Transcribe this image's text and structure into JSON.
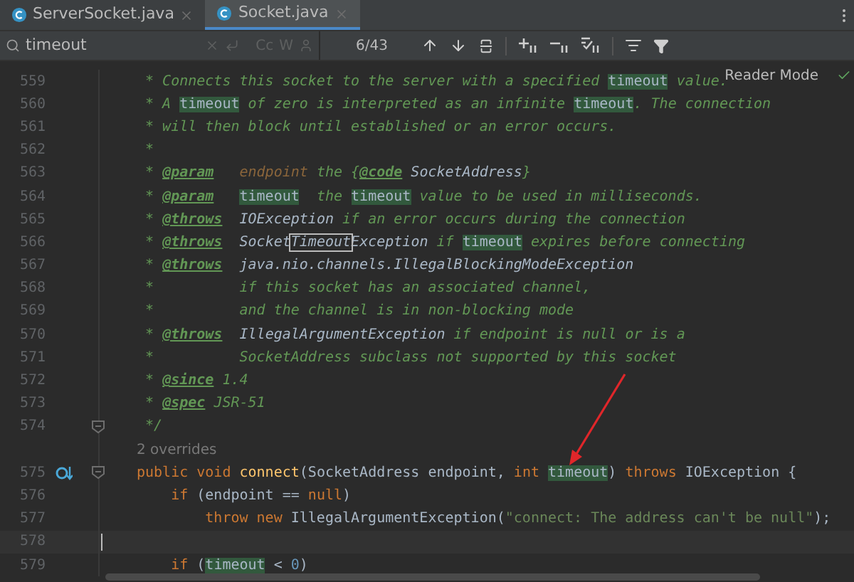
{
  "tabs": [
    {
      "label": "ServerSocket.java",
      "selected": false
    },
    {
      "label": "Socket.java",
      "selected": true
    }
  ],
  "search": {
    "value": "timeout",
    "case_option": "Cc",
    "word_option": "W",
    "match_count": "6/43"
  },
  "reader_mode": "Reader Mode",
  "lines": [
    {
      "kind": "code",
      "number": "559",
      "current": false,
      "fold": false,
      "override": false,
      "tokens": [
        {
          "kind": "doc",
          "text": " * Connects this socket to the server with a specified "
        },
        {
          "kind": "match",
          "text": "timeout"
        },
        {
          "kind": "doc",
          "text": " value."
        }
      ]
    },
    {
      "kind": "code",
      "number": "560",
      "current": false,
      "fold": false,
      "override": false,
      "tokens": [
        {
          "kind": "doc",
          "text": " * A "
        },
        {
          "kind": "match",
          "text": "timeout"
        },
        {
          "kind": "doc",
          "text": " of zero is interpreted as an infinite "
        },
        {
          "kind": "match",
          "text": "timeout"
        },
        {
          "kind": "doc",
          "text": ". The connection"
        }
      ]
    },
    {
      "kind": "code",
      "number": "561",
      "current": false,
      "fold": false,
      "override": false,
      "tokens": [
        {
          "kind": "doc",
          "text": " * will then block until established or an error occurs."
        }
      ]
    },
    {
      "kind": "code",
      "number": "562",
      "current": false,
      "fold": false,
      "override": false,
      "tokens": [
        {
          "kind": "doc",
          "text": " *"
        }
      ]
    },
    {
      "kind": "code",
      "number": "563",
      "current": false,
      "fold": false,
      "override": false,
      "tokens": [
        {
          "kind": "doc",
          "text": " * "
        },
        {
          "kind": "tag",
          "text": "@param"
        },
        {
          "kind": "param",
          "text": "   endpoint"
        },
        {
          "kind": "doc",
          "text": " the {"
        },
        {
          "kind": "tag",
          "text": "@code"
        },
        {
          "kind": "ref",
          "text": " SocketAddress"
        },
        {
          "kind": "doc",
          "text": "}"
        }
      ]
    },
    {
      "kind": "code",
      "number": "564",
      "current": false,
      "fold": false,
      "override": false,
      "tokens": [
        {
          "kind": "doc",
          "text": " * "
        },
        {
          "kind": "tag",
          "text": "@param   "
        },
        {
          "kind": "match",
          "text": "timeout"
        },
        {
          "kind": "doc",
          "text": "  the "
        },
        {
          "kind": "match",
          "text": "timeout"
        },
        {
          "kind": "doc",
          "text": " value to be used in milliseconds."
        }
      ]
    },
    {
      "kind": "code",
      "number": "565",
      "current": false,
      "fold": false,
      "override": false,
      "tokens": [
        {
          "kind": "doc",
          "text": " * "
        },
        {
          "kind": "tag",
          "text": "@throws"
        },
        {
          "kind": "ref",
          "text": "  IOException"
        },
        {
          "kind": "doc",
          "text": " if an error occurs during the connection"
        }
      ]
    },
    {
      "kind": "code",
      "number": "566",
      "current": false,
      "fold": false,
      "override": false,
      "tokens": [
        {
          "kind": "doc",
          "text": " * "
        },
        {
          "kind": "tag",
          "text": "@throws"
        },
        {
          "kind": "ref",
          "text": "  Socket"
        },
        {
          "kind": "current",
          "text": "Timeout"
        },
        {
          "kind": "ref",
          "text": "Exception"
        },
        {
          "kind": "doc",
          "text": " if "
        },
        {
          "kind": "match",
          "text": "timeout"
        },
        {
          "kind": "doc",
          "text": " expires before connecting"
        }
      ]
    },
    {
      "kind": "code",
      "number": "567",
      "current": false,
      "fold": false,
      "override": false,
      "tokens": [
        {
          "kind": "doc",
          "text": " * "
        },
        {
          "kind": "tag",
          "text": "@throws"
        },
        {
          "kind": "ref",
          "text": "  java.nio.channels.IllegalBlockingModeException"
        }
      ]
    },
    {
      "kind": "code",
      "number": "568",
      "current": false,
      "fold": false,
      "override": false,
      "tokens": [
        {
          "kind": "doc",
          "text": " *          if this socket has an associated channel,"
        }
      ]
    },
    {
      "kind": "code",
      "number": "569",
      "current": false,
      "fold": false,
      "override": false,
      "tokens": [
        {
          "kind": "doc",
          "text": " *          and the channel is in non-blocking mode"
        }
      ]
    },
    {
      "kind": "code",
      "number": "570",
      "current": false,
      "fold": false,
      "override": false,
      "tokens": [
        {
          "kind": "doc",
          "text": " * "
        },
        {
          "kind": "tag",
          "text": "@throws"
        },
        {
          "kind": "ref",
          "text": "  IllegalArgumentException"
        },
        {
          "kind": "doc",
          "text": " if endpoint is null or is a"
        }
      ]
    },
    {
      "kind": "code",
      "number": "571",
      "current": false,
      "fold": false,
      "override": false,
      "tokens": [
        {
          "kind": "doc",
          "text": " *          SocketAddress subclass not supported by this socket"
        }
      ]
    },
    {
      "kind": "code",
      "number": "572",
      "current": false,
      "fold": false,
      "override": false,
      "tokens": [
        {
          "kind": "doc",
          "text": " * "
        },
        {
          "kind": "tag",
          "text": "@since"
        },
        {
          "kind": "doc",
          "text": " 1.4"
        }
      ]
    },
    {
      "kind": "code",
      "number": "573",
      "current": false,
      "fold": false,
      "override": false,
      "tokens": [
        {
          "kind": "doc",
          "text": " * "
        },
        {
          "kind": "tag",
          "text": "@spec"
        },
        {
          "kind": "doc",
          "text": " JSR-51"
        }
      ]
    },
    {
      "kind": "code",
      "number": "574",
      "current": false,
      "fold": true,
      "override": false,
      "tokens": [
        {
          "kind": "doc",
          "text": " */"
        }
      ]
    },
    {
      "kind": "hint",
      "text": "2 overrides"
    },
    {
      "kind": "code",
      "number": "575",
      "current": false,
      "fold": true,
      "override": true,
      "tokens": [
        {
          "kind": "kw",
          "text": "public void "
        },
        {
          "kind": "fn",
          "text": "connect"
        },
        {
          "kind": "plain",
          "text": "(SocketAddress endpoint, "
        },
        {
          "kind": "kw",
          "text": "int "
        },
        {
          "kind": "match",
          "text": "timeout"
        },
        {
          "kind": "plain",
          "text": ") "
        },
        {
          "kind": "kw",
          "text": "throws "
        },
        {
          "kind": "plain",
          "text": "IOException {"
        }
      ]
    },
    {
      "kind": "code",
      "number": "576",
      "current": false,
      "fold": false,
      "override": false,
      "tokens": [
        {
          "kind": "kw",
          "text": "    if"
        },
        {
          "kind": "plain",
          "text": " (endpoint == "
        },
        {
          "kind": "kw",
          "text": "null"
        },
        {
          "kind": "plain",
          "text": ")"
        }
      ]
    },
    {
      "kind": "code",
      "number": "577",
      "current": false,
      "fold": false,
      "override": false,
      "tokens": [
        {
          "kind": "kw",
          "text": "        throw new "
        },
        {
          "kind": "plain",
          "text": "IllegalArgumentException("
        },
        {
          "kind": "str",
          "text": "\"connect: The address can't be null\""
        },
        {
          "kind": "plain",
          "text": ");"
        }
      ]
    },
    {
      "kind": "code",
      "number": "578",
      "current": true,
      "fold": false,
      "override": false
    },
    {
      "kind": "code",
      "number": "579",
      "current": false,
      "fold": false,
      "override": false,
      "tokens": [
        {
          "kind": "kw",
          "text": "    if"
        },
        {
          "kind": "plain",
          "text": " ("
        },
        {
          "kind": "match",
          "text": "timeout"
        },
        {
          "kind": "plain",
          "text": " < "
        },
        {
          "kind": "num",
          "text": "0"
        },
        {
          "kind": "plain",
          "text": ")"
        }
      ]
    }
  ]
}
